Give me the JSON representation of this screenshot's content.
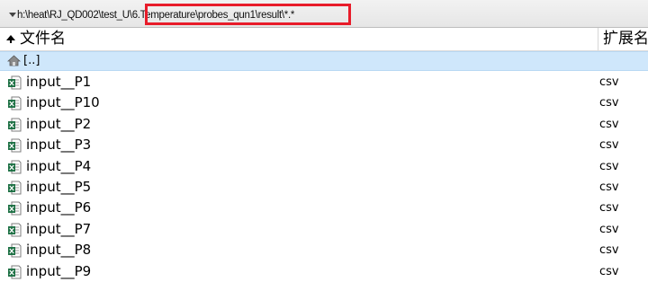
{
  "path_bar": {
    "path_prefix": "h:\\heat\\RJ_QD002\\test_U",
    "path_highlighted": "\\6.Temperature\\probes_qun1\\result\\*.*"
  },
  "header": {
    "sort_indicator": "sort-ascending-icon",
    "name_column": "文件名",
    "ext_column": "扩展名"
  },
  "parent_row": {
    "label": "[..]",
    "icon": "up-folder-icon"
  },
  "files": [
    {
      "name": "input__P1",
      "ext": "csv"
    },
    {
      "name": "input__P10",
      "ext": "csv"
    },
    {
      "name": "input__P2",
      "ext": "csv"
    },
    {
      "name": "input__P3",
      "ext": "csv"
    },
    {
      "name": "input__P4",
      "ext": "csv"
    },
    {
      "name": "input__P5",
      "ext": "csv"
    },
    {
      "name": "input__P6",
      "ext": "csv"
    },
    {
      "name": "input__P7",
      "ext": "csv"
    },
    {
      "name": "input__P8",
      "ext": "csv"
    },
    {
      "name": "input__P9",
      "ext": "csv"
    }
  ],
  "file_icon": "excel-csv-file-icon",
  "colors": {
    "highlight_border": "#e81c2a",
    "selected_row": "#cfe7fb",
    "excel_green": "#1e7145"
  }
}
